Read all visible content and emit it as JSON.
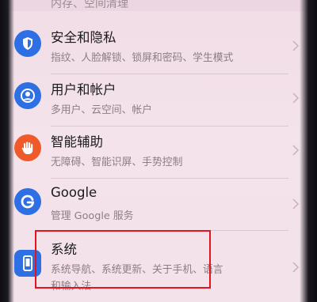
{
  "settings_list": {
    "cut_top_row_subtitle": "内存、空间清理",
    "items": [
      {
        "title": "安全和隐私",
        "subtitle": "指纹、人脸解锁、锁屏和密码、学生模式",
        "icon": "shield-icon",
        "icon_color": "#2f6fe4"
      },
      {
        "title": "用户和帐户",
        "subtitle": "多用户、云空间、帐户",
        "icon": "account-icon",
        "icon_color": "#2f6fe4"
      },
      {
        "title": "智能辅助",
        "subtitle": "无障碍、智能识屏、手势控制",
        "icon": "hand-icon",
        "icon_color": "#f05a2b"
      },
      {
        "title": "Google",
        "subtitle": "管理 Google 服务",
        "icon": "google-g-icon",
        "icon_color": "#2f6fe4"
      },
      {
        "title": "系统",
        "subtitle": "系统导航、系统更新、关于手机、语言",
        "subtitle_line2": "和输入法",
        "icon": "phone-icon",
        "icon_color": "#2f6fe4"
      }
    ]
  },
  "annotation": {
    "highlight_color": "#e4141e"
  }
}
